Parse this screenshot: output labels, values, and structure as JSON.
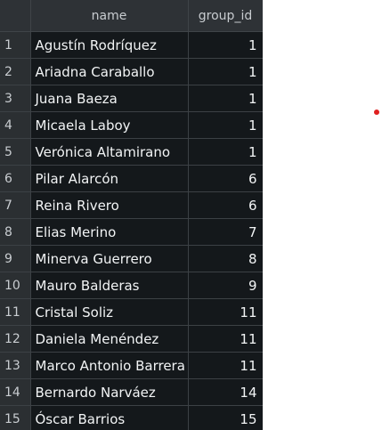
{
  "table": {
    "columns": [
      "",
      "name",
      "group_id"
    ],
    "rows": [
      {
        "index": "1",
        "name": "Agustín Rodríquez",
        "group_id": "1"
      },
      {
        "index": "2",
        "name": "Ariadna Caraballo",
        "group_id": "1"
      },
      {
        "index": "3",
        "name": "Juana Baeza",
        "group_id": "1"
      },
      {
        "index": "4",
        "name": "Micaela Laboy",
        "group_id": "1"
      },
      {
        "index": "5",
        "name": "Verónica Altamirano",
        "group_id": "1"
      },
      {
        "index": "6",
        "name": "Pilar Alarcón",
        "group_id": "6"
      },
      {
        "index": "7",
        "name": "Reina Rivero",
        "group_id": "6"
      },
      {
        "index": "8",
        "name": "Elias Merino",
        "group_id": "7"
      },
      {
        "index": "9",
        "name": "Minerva Guerrero",
        "group_id": "8"
      },
      {
        "index": "10",
        "name": "Mauro Balderas",
        "group_id": "9"
      },
      {
        "index": "11",
        "name": "Cristal Soliz",
        "group_id": "11"
      },
      {
        "index": "12",
        "name": "Daniela Menéndez",
        "group_id": "11"
      },
      {
        "index": "13",
        "name": "Marco Antonio Barrera",
        "group_id": "11"
      },
      {
        "index": "14",
        "name": "Bernardo Narváez",
        "group_id": "14"
      },
      {
        "index": "15",
        "name": "Óscar Barrios",
        "group_id": "15"
      }
    ]
  },
  "colors": {
    "grid_background": "#1f2326",
    "cell_background": "#14181b",
    "header_background": "#2e3236",
    "text": "#f2f4f5",
    "marker": "#e02020"
  }
}
